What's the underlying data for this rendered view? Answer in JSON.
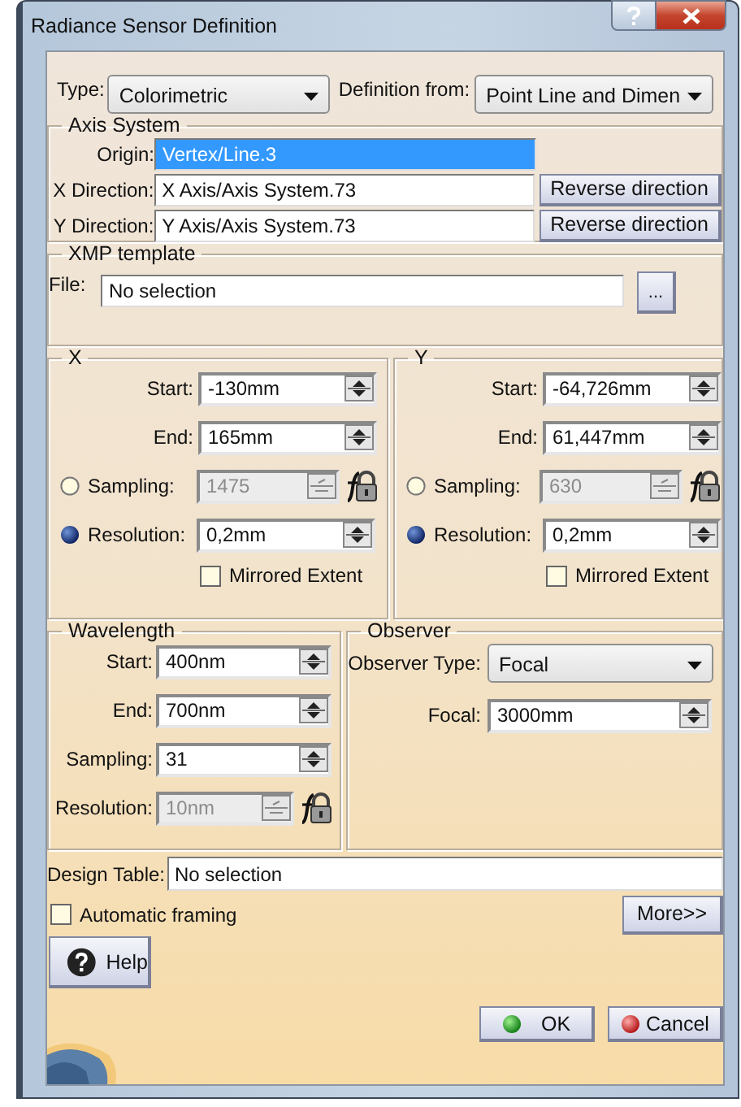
{
  "window": {
    "title": "Radiance Sensor Definition"
  },
  "type": {
    "label": "Type:",
    "value": "Colorimetric"
  },
  "definition_from": {
    "label": "Definition from:",
    "value": "Point Line and Dimen"
  },
  "axis_system": {
    "title": "Axis System",
    "rows": [
      {
        "label": "Origin:",
        "value": "Vertex/Line.3",
        "selected": true
      },
      {
        "label": "X Direction:",
        "value": "X Axis/Axis System.73",
        "selected": false,
        "button": "Reverse direction"
      },
      {
        "label": "Y Direction:",
        "value": "Y Axis/Axis System.73",
        "selected": false,
        "button": "Reverse direction"
      }
    ]
  },
  "xmp_template": {
    "title": "XMP template",
    "label": "File:",
    "value": "No selection",
    "browse_button": "..."
  },
  "ranges": [
    {
      "title": "X",
      "start": {
        "label": "Start:",
        "value": "-130mm"
      },
      "end": {
        "label": "End:",
        "value": "165mm"
      },
      "sampling": {
        "label": "Sampling:",
        "value": "1475",
        "selected": false,
        "disabled": true
      },
      "resolution": {
        "label": "Resolution:",
        "value": "0,2mm",
        "selected": true,
        "disabled": false
      },
      "mirrored": {
        "label": "Mirrored Extent",
        "checked": false
      }
    },
    {
      "title": "Y",
      "start": {
        "label": "Start:",
        "value": "-64,726mm"
      },
      "end": {
        "label": "End:",
        "value": "61,447mm"
      },
      "sampling": {
        "label": "Sampling:",
        "value": "630",
        "selected": false,
        "disabled": true
      },
      "resolution": {
        "label": "Resolution:",
        "value": "0,2mm",
        "selected": true,
        "disabled": false
      },
      "mirrored": {
        "label": "Mirrored Extent",
        "checked": false
      }
    }
  ],
  "wavelength": {
    "title": "Wavelength",
    "fields": [
      {
        "label": "Start:",
        "value": "400nm",
        "disabled": false
      },
      {
        "label": "End:",
        "value": "700nm",
        "disabled": false
      },
      {
        "label": "Sampling:",
        "value": "31",
        "disabled": false
      },
      {
        "label": "Resolution:",
        "value": "10nm",
        "disabled": true
      }
    ]
  },
  "observer": {
    "title": "Observer",
    "type": {
      "label": "Observer Type:",
      "value": "Focal"
    },
    "focal": {
      "label": "Focal:",
      "value": "3000mm"
    }
  },
  "design_table": {
    "label": "Design Table:",
    "value": "No selection"
  },
  "automatic_framing": {
    "label": "Automatic framing",
    "checked": false
  },
  "buttons": {
    "more": "More>>",
    "help": "Help",
    "ok": "OK",
    "cancel": "Cancel"
  }
}
